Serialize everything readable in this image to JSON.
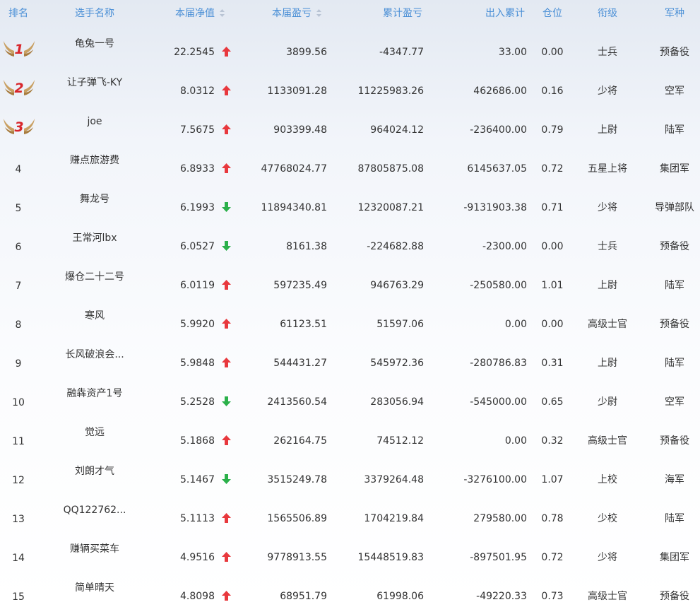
{
  "columns": {
    "rank": "排名",
    "name": "选手名称",
    "net_value": "本届净值",
    "profit": "本届盈亏",
    "total_profit": "累计盈亏",
    "flow": "出入累计",
    "position": "仓位",
    "level": "衔级",
    "branch": "军种"
  },
  "sort_icon": "sort-updown-icon",
  "colors": {
    "header_text": "#4a8fd6",
    "up": "#e8383d",
    "down": "#2bb04a",
    "medal_gold": "#c9a063",
    "medal_red": "#d8262c"
  },
  "rows": [
    {
      "rank": "1",
      "medal": true,
      "name": "龟兔一号",
      "net": "22.2545",
      "dir": "up",
      "profit": "3899.56",
      "total": "-4347.77",
      "flow": "33.00",
      "pos": "0.00",
      "level": "士兵",
      "branch": "预备役"
    },
    {
      "rank": "2",
      "medal": true,
      "name": "让子弹飞-KY",
      "net": "8.0312",
      "dir": "up",
      "profit": "1133091.28",
      "total": "11225983.26",
      "flow": "462686.00",
      "pos": "0.16",
      "level": "少将",
      "branch": "空军"
    },
    {
      "rank": "3",
      "medal": true,
      "name": "joe",
      "net": "7.5675",
      "dir": "up",
      "profit": "903399.48",
      "total": "964024.12",
      "flow": "-236400.00",
      "pos": "0.79",
      "level": "上尉",
      "branch": "陆军"
    },
    {
      "rank": "4",
      "medal": false,
      "name": "赚点旅游费",
      "net": "6.8933",
      "dir": "up",
      "profit": "47768024.77",
      "total": "87805875.08",
      "flow": "6145637.05",
      "pos": "0.72",
      "level": "五星上将",
      "branch": "集团军"
    },
    {
      "rank": "5",
      "medal": false,
      "name": "舞龙号",
      "net": "6.1993",
      "dir": "down",
      "profit": "11894340.81",
      "total": "12320087.21",
      "flow": "-9131903.38",
      "pos": "0.71",
      "level": "少将",
      "branch": "导弹部队"
    },
    {
      "rank": "6",
      "medal": false,
      "name": "王常河lbx",
      "net": "6.0527",
      "dir": "down",
      "profit": "8161.38",
      "total": "-224682.88",
      "flow": "-2300.00",
      "pos": "0.00",
      "level": "士兵",
      "branch": "预备役"
    },
    {
      "rank": "7",
      "medal": false,
      "name": "爆仓二十二号",
      "net": "6.0119",
      "dir": "up",
      "profit": "597235.49",
      "total": "946763.29",
      "flow": "-250580.00",
      "pos": "1.01",
      "level": "上尉",
      "branch": "陆军"
    },
    {
      "rank": "8",
      "medal": false,
      "name": "寒风",
      "net": "5.9920",
      "dir": "up",
      "profit": "61123.51",
      "total": "51597.06",
      "flow": "0.00",
      "pos": "0.00",
      "level": "高级士官",
      "branch": "预备役"
    },
    {
      "rank": "9",
      "medal": false,
      "name": "长风破浪会...",
      "net": "5.9848",
      "dir": "up",
      "profit": "544431.27",
      "total": "545972.36",
      "flow": "-280786.83",
      "pos": "0.31",
      "level": "上尉",
      "branch": "陆军"
    },
    {
      "rank": "10",
      "medal": false,
      "name": "融犇资产1号",
      "net": "5.2528",
      "dir": "down",
      "profit": "2413560.54",
      "total": "283056.94",
      "flow": "-545000.00",
      "pos": "0.65",
      "level": "少尉",
      "branch": "空军"
    },
    {
      "rank": "11",
      "medal": false,
      "name": "觉远",
      "net": "5.1868",
      "dir": "up",
      "profit": "262164.75",
      "total": "74512.12",
      "flow": "0.00",
      "pos": "0.32",
      "level": "高级士官",
      "branch": "预备役"
    },
    {
      "rank": "12",
      "medal": false,
      "name": "刘朗才气",
      "net": "5.1467",
      "dir": "down",
      "profit": "3515249.78",
      "total": "3379264.48",
      "flow": "-3276100.00",
      "pos": "1.07",
      "level": "上校",
      "branch": "海军"
    },
    {
      "rank": "13",
      "medal": false,
      "name": "QQ122762...",
      "net": "5.1113",
      "dir": "up",
      "profit": "1565506.89",
      "total": "1704219.84",
      "flow": "279580.00",
      "pos": "0.78",
      "level": "少校",
      "branch": "陆军"
    },
    {
      "rank": "14",
      "medal": false,
      "name": "赚辆买菜车",
      "net": "4.9516",
      "dir": "up",
      "profit": "9778913.55",
      "total": "15448519.83",
      "flow": "-897501.95",
      "pos": "0.72",
      "level": "少将",
      "branch": "集团军"
    },
    {
      "rank": "15",
      "medal": false,
      "name": "简单晴天",
      "net": "4.8098",
      "dir": "up",
      "profit": "68951.79",
      "total": "61998.06",
      "flow": "-49220.33",
      "pos": "0.73",
      "level": "高级士官",
      "branch": "预备役"
    }
  ]
}
